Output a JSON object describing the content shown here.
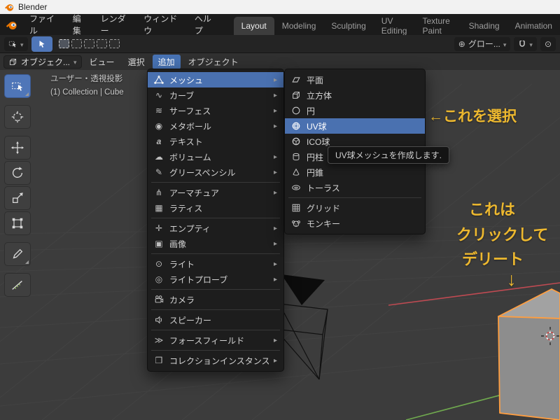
{
  "titlebar": {
    "app_name": "Blender"
  },
  "menubar": {
    "menus": [
      {
        "label": "ファイル"
      },
      {
        "label": "編集"
      },
      {
        "label": "レンダー"
      },
      {
        "label": "ウィンドウ"
      },
      {
        "label": "ヘルプ"
      }
    ],
    "workspaces": [
      {
        "label": "Layout",
        "active": true
      },
      {
        "label": "Modeling"
      },
      {
        "label": "Sculpting"
      },
      {
        "label": "UV Editing"
      },
      {
        "label": "Texture Paint"
      },
      {
        "label": "Shading"
      },
      {
        "label": "Animation"
      }
    ]
  },
  "tool_settings": {
    "orientation_label": "グロー..."
  },
  "viewport_header": {
    "mode_label": "オブジェク...",
    "menus": [
      {
        "label": "ビュー"
      },
      {
        "label": "選択"
      },
      {
        "label": "追加",
        "active": true
      },
      {
        "label": "オブジェクト"
      }
    ]
  },
  "viewport_info": {
    "line1": "ユーザー・透視投影",
    "line2": "(1) Collection | Cube"
  },
  "left_toolbar": {
    "tools": [
      {
        "icon": "select-box-tool-icon",
        "active": true
      },
      {
        "icon": "cursor-tool-icon"
      },
      {
        "icon": "move-tool-icon"
      },
      {
        "icon": "rotate-tool-icon"
      },
      {
        "icon": "scale-tool-icon"
      },
      {
        "icon": "transform-tool-icon"
      },
      {
        "icon": "annotate-tool-icon"
      },
      {
        "icon": "measure-tool-icon"
      }
    ]
  },
  "add_menu": {
    "items": [
      {
        "label": "メッシュ",
        "icon": "mesh-icon",
        "submenu": true,
        "highlighted": true
      },
      {
        "label": "カーブ",
        "icon": "curve-icon",
        "submenu": true
      },
      {
        "label": "サーフェス",
        "icon": "surface-icon",
        "submenu": true
      },
      {
        "label": "メタボール",
        "icon": "metaball-icon",
        "submenu": true
      },
      {
        "label": "テキスト",
        "icon": "text-icon",
        "submenu": false
      },
      {
        "label": "ボリューム",
        "icon": "volume-icon",
        "submenu": true
      },
      {
        "label": "グリースペンシル",
        "icon": "grease-pencil-icon",
        "submenu": true
      },
      {
        "label": "アーマチュア",
        "icon": "armature-icon",
        "submenu": true
      },
      {
        "label": "ラティス",
        "icon": "lattice-icon",
        "submenu": false
      },
      {
        "label": "エンプティ",
        "icon": "empty-icon",
        "submenu": true
      },
      {
        "label": "画像",
        "icon": "image-icon",
        "submenu": true
      },
      {
        "label": "ライト",
        "icon": "light-icon",
        "submenu": true
      },
      {
        "label": "ライトプローブ",
        "icon": "light-probe-icon",
        "submenu": true
      },
      {
        "label": "カメラ",
        "icon": "camera-icon",
        "submenu": false
      },
      {
        "label": "スピーカー",
        "icon": "speaker-icon",
        "submenu": false
      },
      {
        "label": "フォースフィールド",
        "icon": "force-field-icon",
        "submenu": true
      },
      {
        "label": "コレクションインスタンス",
        "icon": "collection-instance-icon",
        "submenu": true
      }
    ]
  },
  "mesh_submenu": {
    "items": [
      {
        "label": "平面",
        "icon": "plane-icon"
      },
      {
        "label": "立方体",
        "icon": "cube-icon"
      },
      {
        "label": "円",
        "icon": "circle-icon"
      },
      {
        "label": "UV球",
        "icon": "uv-sphere-icon",
        "highlighted": true
      },
      {
        "label": "ICO球",
        "icon": "ico-sphere-icon"
      },
      {
        "label": "円柱",
        "icon": "cylinder-icon"
      },
      {
        "label": "円錐",
        "icon": "cone-icon"
      },
      {
        "label": "トーラス",
        "icon": "torus-icon"
      },
      {
        "label": "グリッド",
        "icon": "grid-icon"
      },
      {
        "label": "モンキー",
        "icon": "monkey-icon"
      }
    ]
  },
  "tooltip": {
    "text": "UV球メッシュを作成します."
  },
  "annotations": {
    "select_label": "←これを選択",
    "delete_line1": "これは",
    "delete_line2": "クリックして",
    "delete_line3": "デリート",
    "delete_arrow": "↓"
  },
  "colors": {
    "accent_blue": "#4772b3",
    "annotation_yellow": "#edb82f",
    "selection_orange": "#ff9e40",
    "axis_red": "#bf4a52",
    "axis_green": "#6fa84e"
  }
}
